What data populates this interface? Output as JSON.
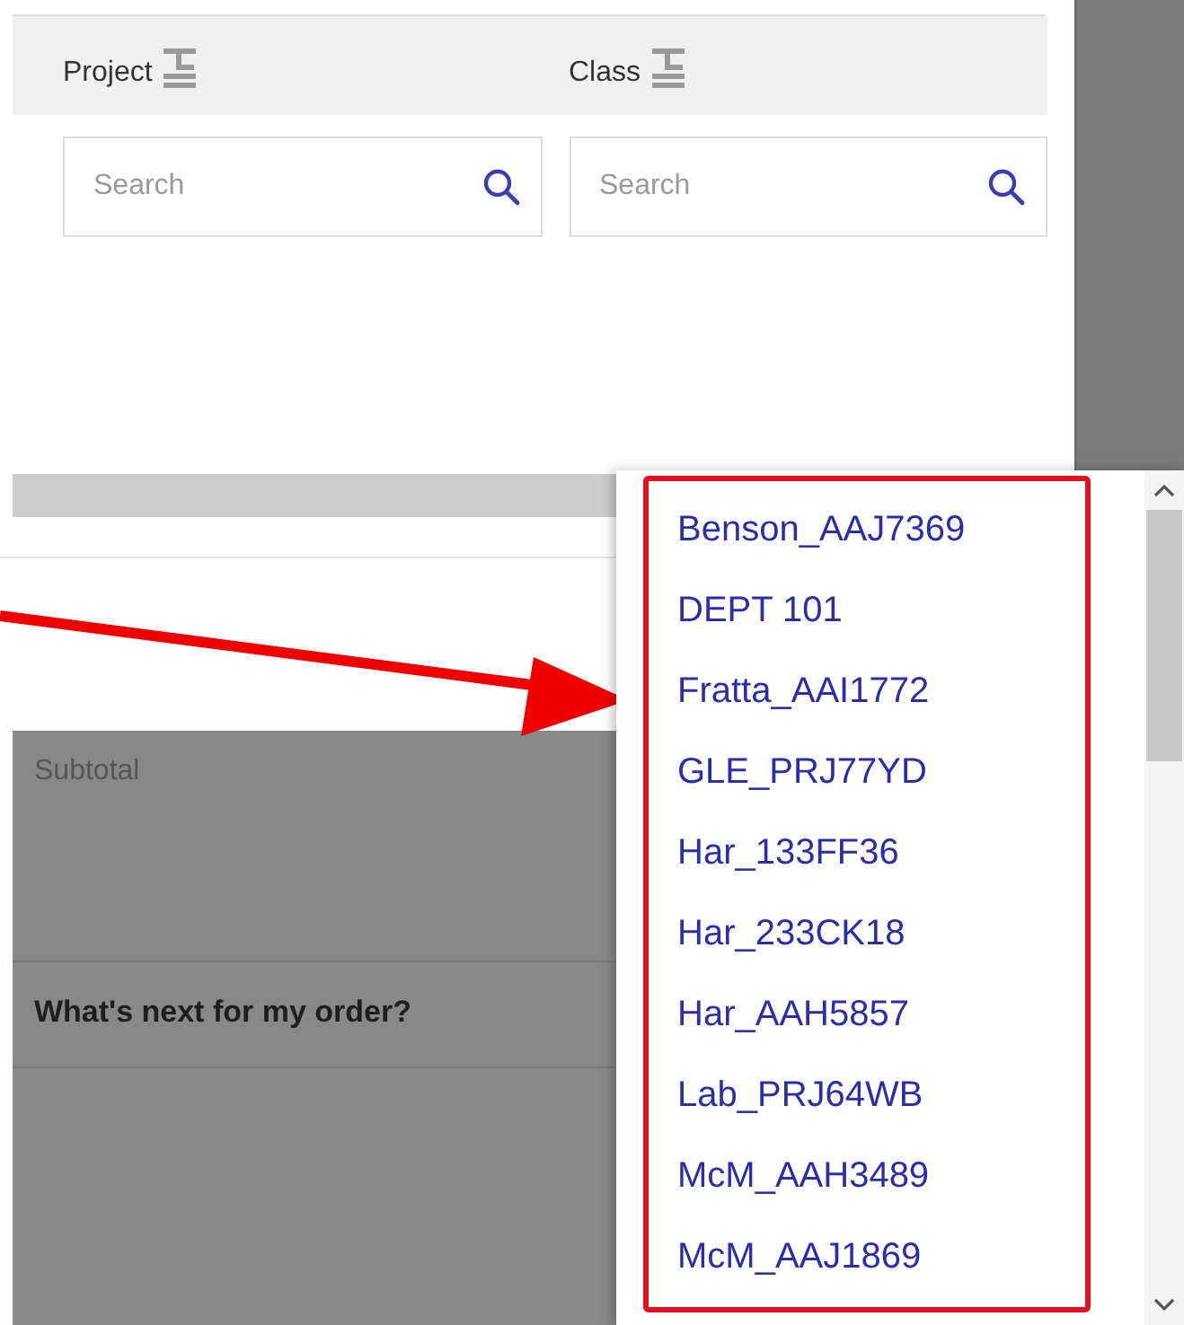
{
  "columns": [
    {
      "label": "Project",
      "search": {
        "placeholder": "Search"
      }
    },
    {
      "label": "Class",
      "search": {
        "placeholder": "Search"
      }
    }
  ],
  "summary": {
    "subtotal_label": "Subtotal",
    "next_heading": "What's next for my order?"
  },
  "dropdown": {
    "options": [
      {
        "label": "Benson_AAJ7369"
      },
      {
        "label": "DEPT 101"
      },
      {
        "label": "Fratta_AAI1772"
      },
      {
        "label": "GLE_PRJ77YD"
      },
      {
        "label": "Har_133FF36"
      },
      {
        "label": "Har_233CK18"
      },
      {
        "label": "Har_AAH5857"
      },
      {
        "label": "Lab_PRJ64WB"
      },
      {
        "label": "McM_AAH3489"
      },
      {
        "label": "McM_AAJ1869"
      }
    ]
  }
}
